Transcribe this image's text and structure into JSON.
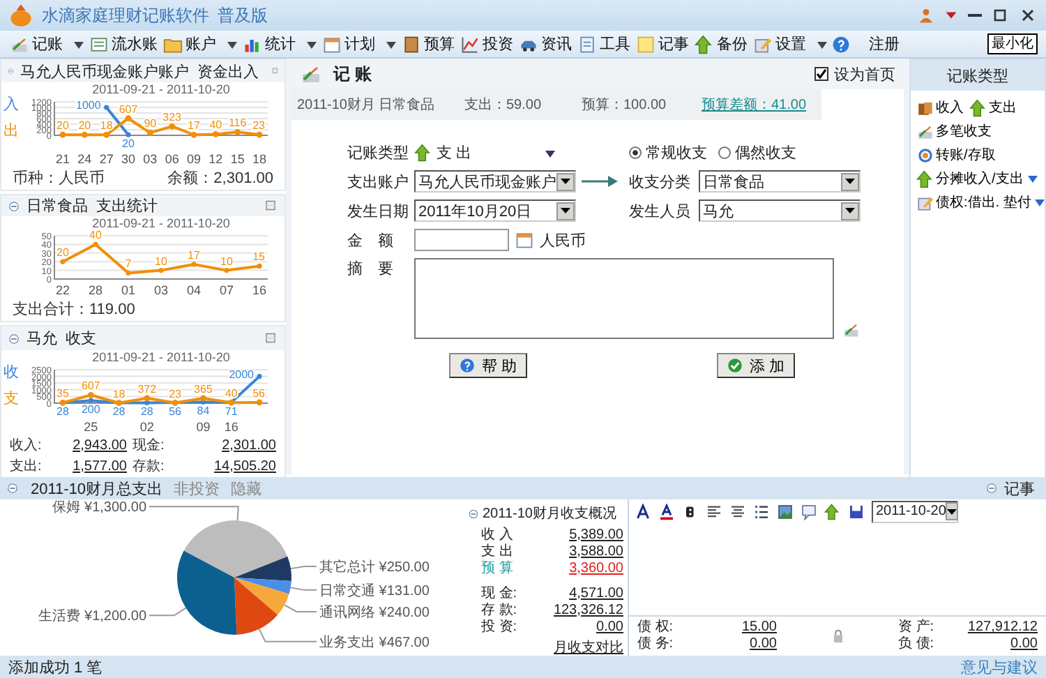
{
  "window": {
    "title": "水滴家庭理财记账软件",
    "edition": "普及版",
    "minimize_button": "最小化"
  },
  "toolbar": [
    {
      "label": "记账",
      "kind": "menu"
    },
    {
      "label": "流水账",
      "kind": "button"
    },
    {
      "label": "账户",
      "kind": "menu"
    },
    {
      "label": "统计",
      "kind": "menu"
    },
    {
      "label": "计划",
      "kind": "menu"
    },
    {
      "label": "预算",
      "kind": "button"
    },
    {
      "label": "投资",
      "kind": "button"
    },
    {
      "label": "资讯",
      "kind": "button"
    },
    {
      "label": "工具",
      "kind": "button"
    },
    {
      "label": "记事",
      "kind": "button"
    },
    {
      "label": "备份",
      "kind": "button"
    },
    {
      "label": "设置",
      "kind": "menu"
    },
    {
      "label": "注册",
      "kind": "text"
    }
  ],
  "left_panels": [
    {
      "title": "马允人民币现金账户账户  资金出入",
      "chart_data": {
        "type": "line",
        "title": "2011-09-21 - 2011-10-20",
        "categories": [
          "21",
          "24",
          "27",
          "30",
          "03",
          "06",
          "09",
          "12",
          "15",
          "18"
        ],
        "ylim": [
          0,
          1200
        ],
        "yticks": [
          0,
          200,
          400,
          600,
          800,
          1000,
          1200
        ],
        "grid": true,
        "data_labels": true,
        "series": [
          {
            "name": "入",
            "color": "#3a85d8",
            "marker": "circle",
            "values": [
              null,
              null,
              1000,
              20,
              null,
              null,
              null,
              null,
              null,
              null
            ]
          },
          {
            "name": "出",
            "color": "#f0900a",
            "marker": "circle",
            "values": [
              20,
              20,
              18,
              607,
              90,
              323,
              17,
              40,
              116,
              23
            ]
          }
        ]
      },
      "notes": [
        "币种：人民币",
        "余额：2,301.00"
      ]
    },
    {
      "title": "日常食品  支出统计",
      "chart_data": {
        "type": "line",
        "title": "2011-09-21 - 2011-10-20",
        "categories": [
          "22",
          "28",
          "01",
          "03",
          "04",
          "07",
          "16"
        ],
        "ylim": [
          0,
          50
        ],
        "yticks": [
          0,
          10,
          20,
          30,
          40,
          50
        ],
        "grid": true,
        "data_labels": true,
        "series": [
          {
            "color": "#f0900a",
            "marker": "circle",
            "values": [
              20,
              40,
              7,
              10,
              17,
              10,
              15
            ]
          }
        ]
      },
      "notes": [
        "支出合计：119.00"
      ]
    },
    {
      "title": "马允  收支",
      "chart_data": {
        "type": "line",
        "title": "2011-09-21 - 2011-10-20",
        "categories": [
          null,
          "25",
          null,
          "02",
          null,
          "09",
          "16",
          null
        ],
        "ylim": [
          0,
          2500
        ],
        "yticks": [
          0,
          500,
          1000,
          1500,
          2000,
          2500
        ],
        "grid": true,
        "data_labels": true,
        "series": [
          {
            "name": "收",
            "color": "#3a85d8",
            "marker": "circle",
            "values": [
              28,
              200,
              28,
              28,
              56,
              84,
              71,
              2000
            ]
          },
          {
            "name": "支",
            "color": "#f0900a",
            "marker": "circle",
            "values": [
              35,
              607,
              18,
              372,
              23,
              365,
              40,
              56
            ]
          }
        ]
      },
      "stats": [
        {
          "label": "收入:",
          "value": "2,943.00"
        },
        {
          "label": "现金:",
          "value": "2,301.00"
        },
        {
          "label": "支出:",
          "value": "1,577.00"
        },
        {
          "label": "存款:",
          "value": "14,505.20"
        }
      ]
    }
  ],
  "center": {
    "title": "记 账",
    "set_home": {
      "label": "设为首页",
      "checked": true
    },
    "info": {
      "period": "2011-10财月 日常食品",
      "spent": "支出：59.00",
      "budget": "预算：100.00",
      "difference": "预算差额：41.00"
    }
  },
  "form": {
    "type_label": "记账类型",
    "type_value": "支 出",
    "modes": [
      {
        "label": "常规收支",
        "selected": true
      },
      {
        "label": "偶然收支",
        "selected": false
      }
    ],
    "account_label": "支出账户",
    "account": "马允人民币现金账户",
    "category_label": "收支分类",
    "category": "日常食品",
    "date_label": "发生日期",
    "date": "2011年10月20日",
    "person_label": "发生人员",
    "person": "马允",
    "amount_label": "金　额",
    "currency": "人民币",
    "memo_label": "摘　要",
    "buttons": [
      {
        "label": "帮 助",
        "kind": "help"
      },
      {
        "label": "添 加",
        "kind": "add"
      }
    ]
  },
  "record_types": {
    "title": "记账类型",
    "rows": [
      {
        "items": [
          {
            "label": "收入",
            "dropdown": false
          },
          {
            "label": "支出",
            "dropdown": false
          }
        ]
      },
      {
        "items": [
          {
            "label": "多笔收支",
            "dropdown": false
          }
        ]
      },
      {
        "items": [
          {
            "label": "转账/存取",
            "dropdown": false
          }
        ]
      },
      {
        "items": [
          {
            "label": "分摊收入/支出",
            "dropdown": true
          }
        ]
      },
      {
        "items": [
          {
            "label": "债权:借出. 垫付",
            "dropdown": true
          }
        ]
      }
    ]
  },
  "bottom": {
    "title": "2011-10财月总支出",
    "links": [
      "非投资",
      "隐藏"
    ],
    "chart_data": {
      "type": "pie",
      "categories": [
        "保姆",
        "其它总计",
        "日常交通",
        "通讯网络",
        "业务支出",
        "生活费"
      ],
      "series": [
        {
          "values": [
            36.23,
            6.97,
            3.65,
            6.69,
            13.02,
            33.44
          ]
        }
      ],
      "value_labels": [
        "¥1,300.00",
        "¥250.00",
        "¥131.00",
        "¥240.00",
        "¥467.00",
        "¥1,200.00"
      ]
    },
    "summary": {
      "title": "2011-10财月收支概况",
      "rows": [
        {
          "label": "收 入",
          "value": "5,389.00",
          "kind": "normal"
        },
        {
          "label": "支 出",
          "value": "3,588.00",
          "kind": "normal"
        },
        {
          "label": "预 算",
          "value": "3,360.00",
          "kind": "budget"
        },
        {
          "label": "现 金:",
          "value": "4,571.00",
          "kind": "gap"
        },
        {
          "label": "存 款:",
          "value": "123,326.12",
          "kind": "normal"
        },
        {
          "label": "投 资:",
          "value": "0.00",
          "kind": "normal"
        }
      ],
      "link": "月收支对比"
    },
    "notes": {
      "title": "记事",
      "date": "2011-10-20",
      "left": [
        {
          "label": "债 权:",
          "value": "15.00"
        },
        {
          "label": "债 务:",
          "value": "0.00"
        }
      ],
      "right": [
        {
          "label": "资 产:",
          "value": "127,912.12"
        },
        {
          "label": "负 债:",
          "value": "0.00"
        }
      ]
    }
  },
  "status_bar": {
    "message": "添加成功 1 笔",
    "link": "意见与建议"
  }
}
